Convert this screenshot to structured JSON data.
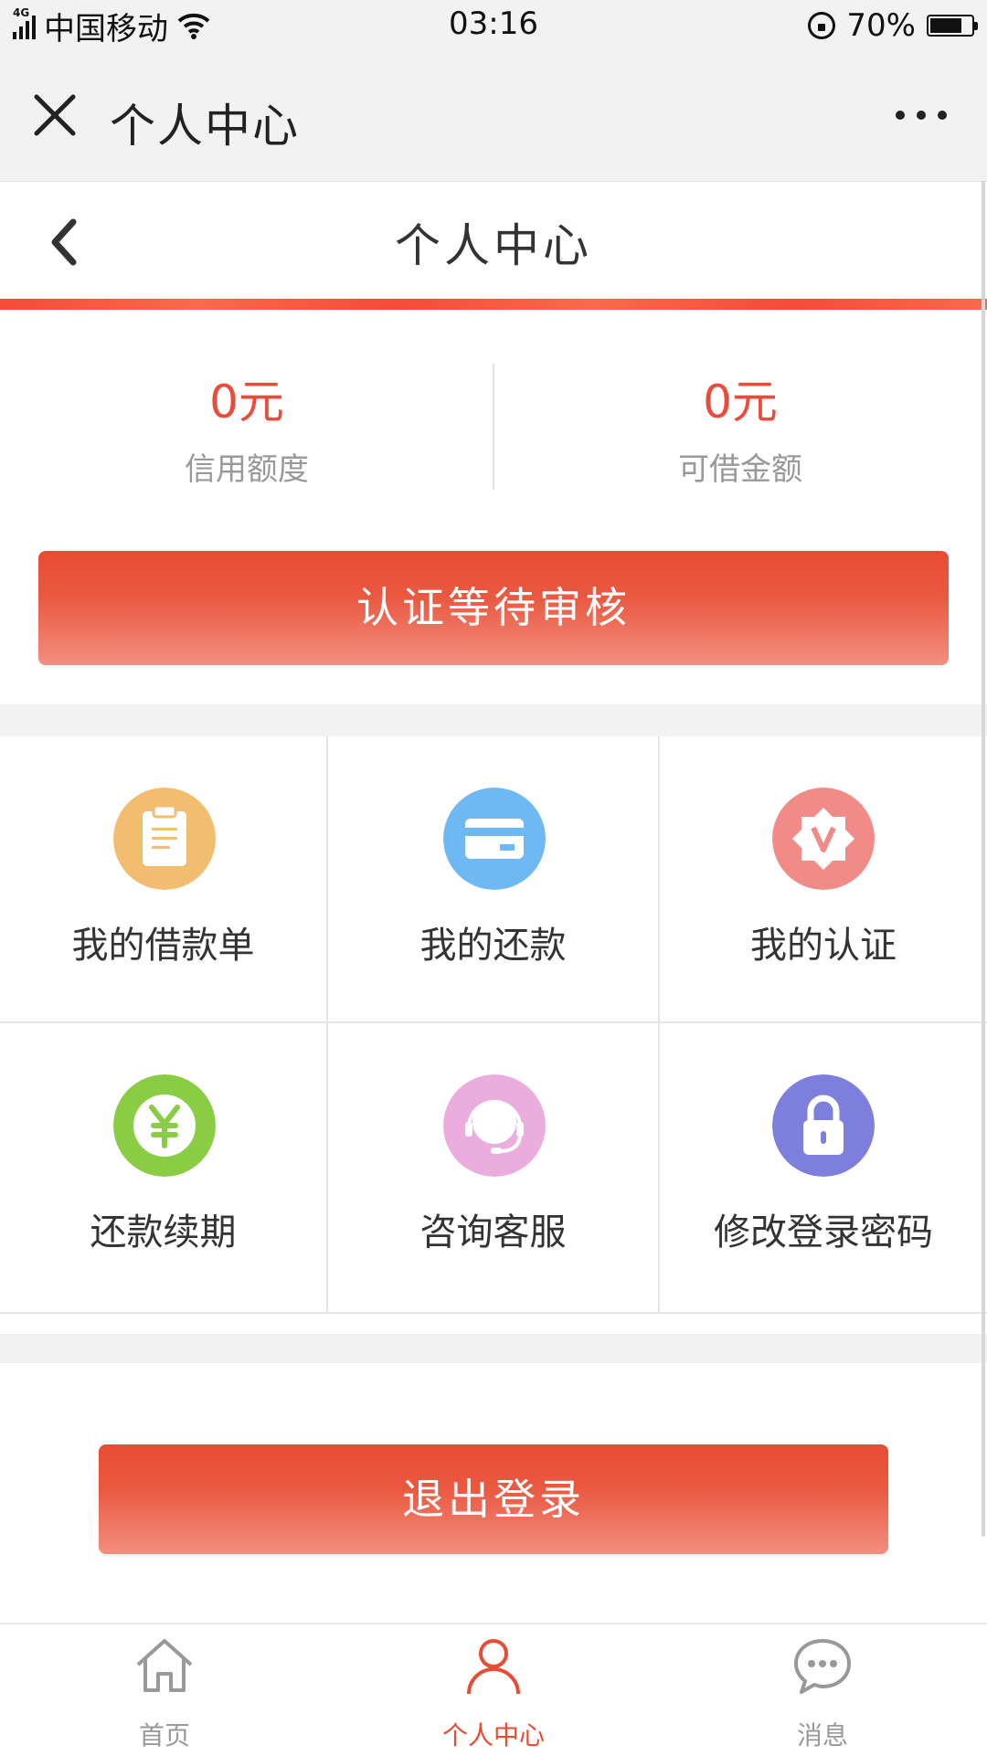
{
  "status_bar": {
    "network": "4G",
    "carrier": "中国移动",
    "time": "03:16",
    "battery": "70%"
  },
  "wechat_bar": {
    "title": "个人中心"
  },
  "header": {
    "title": "个人中心"
  },
  "credit": {
    "limit_value": "0元",
    "limit_label": "信用额度",
    "available_value": "0元",
    "available_label": "可借金额"
  },
  "verify_button": "认证等待审核",
  "grid": [
    {
      "label": "我的借款单",
      "icon": "clipboard-icon",
      "color": "#f2bd6e"
    },
    {
      "label": "我的还款",
      "icon": "card-icon",
      "color": "#6eb8f4"
    },
    {
      "label": "我的认证",
      "icon": "badge-v-icon",
      "color": "#f08b87"
    },
    {
      "label": "还款续期",
      "icon": "yen-icon",
      "color": "#8bcc45"
    },
    {
      "label": "咨询客服",
      "icon": "headset-icon",
      "color": "#eaadde"
    },
    {
      "label": "修改登录密码",
      "icon": "lock-icon",
      "color": "#7e7fdd"
    }
  ],
  "logout_button": "退出登录",
  "tabs": [
    {
      "label": "首页",
      "icon": "home-icon"
    },
    {
      "label": "个人中心",
      "icon": "person-icon",
      "active": true
    },
    {
      "label": "消息",
      "icon": "chat-icon"
    }
  ],
  "colors": {
    "accent_red": "#e84c33",
    "value_red": "#ee4a3a"
  }
}
